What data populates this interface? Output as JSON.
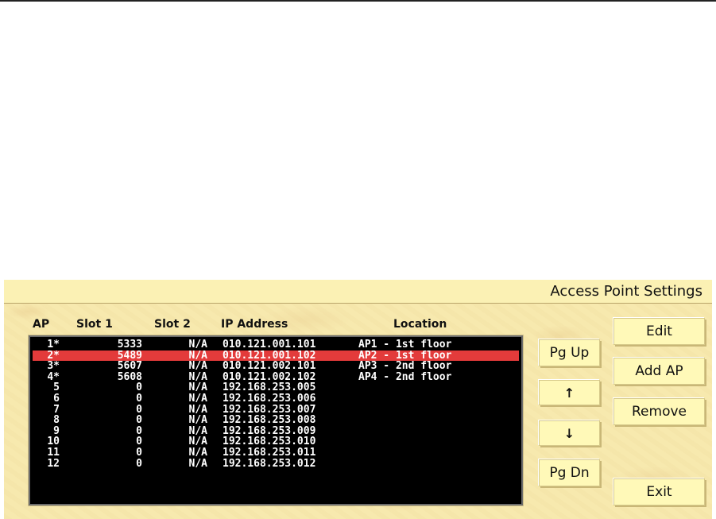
{
  "window": {
    "title": "Access Point Settings"
  },
  "columns": {
    "ap": "AP",
    "slot1": "Slot 1",
    "slot2": "Slot 2",
    "ip": "IP Address",
    "location": "Location"
  },
  "rows": [
    {
      "ap": "1*",
      "slot1": "5333",
      "slot2": "N/A",
      "ip": "010.121.001.101",
      "location": "AP1 - 1st floor"
    },
    {
      "ap": "2*",
      "slot1": "5489",
      "slot2": "N/A",
      "ip": "010.121.001.102",
      "location": "AP2 - 1st floor"
    },
    {
      "ap": "3*",
      "slot1": "5607",
      "slot2": "N/A",
      "ip": "010.121.002.101",
      "location": "AP3 - 2nd floor"
    },
    {
      "ap": "4*",
      "slot1": "5608",
      "slot2": "N/A",
      "ip": "010.121.002.102",
      "location": "AP4 - 2nd floor"
    },
    {
      "ap": "5",
      "slot1": "0",
      "slot2": "N/A",
      "ip": "192.168.253.005",
      "location": ""
    },
    {
      "ap": "6",
      "slot1": "0",
      "slot2": "N/A",
      "ip": "192.168.253.006",
      "location": ""
    },
    {
      "ap": "7",
      "slot1": "0",
      "slot2": "N/A",
      "ip": "192.168.253.007",
      "location": ""
    },
    {
      "ap": "8",
      "slot1": "0",
      "slot2": "N/A",
      "ip": "192.168.253.008",
      "location": ""
    },
    {
      "ap": "9",
      "slot1": "0",
      "slot2": "N/A",
      "ip": "192.168.253.009",
      "location": ""
    },
    {
      "ap": "10",
      "slot1": "0",
      "slot2": "N/A",
      "ip": "192.168.253.010",
      "location": ""
    },
    {
      "ap": "11",
      "slot1": "0",
      "slot2": "N/A",
      "ip": "192.168.253.011",
      "location": ""
    },
    {
      "ap": "12",
      "slot1": "0",
      "slot2": "N/A",
      "ip": "192.168.253.012",
      "location": ""
    }
  ],
  "selected_row": 2,
  "nav_buttons": {
    "page_up": "Pg Up",
    "up_arrow": "↑",
    "down_arrow": "↓",
    "page_down": "Pg Dn"
  },
  "action_buttons": {
    "edit": "Edit",
    "add_ap": "Add AP",
    "remove": "Remove",
    "exit": "Exit"
  },
  "colors": {
    "panel": "#f7e9ae",
    "list_bg": "#000000",
    "list_text": "#ffffff",
    "selection": "#e33b3b",
    "button": "#fff9b8"
  }
}
